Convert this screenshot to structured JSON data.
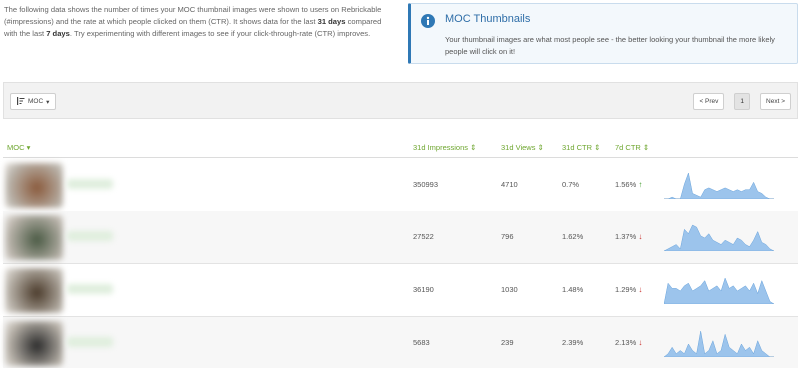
{
  "intro": {
    "part1": "The following data shows the number of times your MOC thumbnail images were shown to users on Rebrickable (#impressions) and the rate at which people clicked on them (CTR). It shows data for the last ",
    "bold1": "31 days",
    "part2": " compared with the last ",
    "bold2": "7 days",
    "part3": ". Try experimenting with different images to see if your click-through-rate (CTR) improves."
  },
  "info": {
    "title": "MOC Thumbnails",
    "body": "Your thumbnail images are what most people see - the better looking your thumbnail the more likely people will click on it!"
  },
  "toolbar": {
    "sort_label": "MOC",
    "prev_label": "< Prev",
    "page_label": "1",
    "next_label": "Next >"
  },
  "table": {
    "headers": {
      "moc": "MOC",
      "impressions": "31d Impressions",
      "views": "31d Views",
      "ctr31": "31d CTR",
      "ctr7": "7d CTR"
    },
    "rows": [
      {
        "impressions": "350993",
        "views": "4710",
        "ctr31": "0.7%",
        "ctr7": "1.56%",
        "trend": "up",
        "thumb_color": "#8a5a3c",
        "spark": [
          0,
          0,
          1,
          0,
          0,
          8,
          14,
          3,
          2,
          1,
          5,
          6,
          5,
          4,
          5,
          6,
          5,
          4,
          5,
          4,
          5,
          5,
          9,
          4,
          3,
          1,
          0,
          0
        ]
      },
      {
        "impressions": "27522",
        "views": "796",
        "ctr31": "1.62%",
        "ctr7": "1.37%",
        "trend": "down",
        "thumb_color": "#4a5a44",
        "spark": [
          0,
          1,
          2,
          3,
          1,
          10,
          8,
          12,
          11,
          7,
          6,
          8,
          5,
          4,
          3,
          5,
          4,
          3,
          6,
          5,
          3,
          2,
          5,
          9,
          4,
          3,
          1,
          0
        ]
      },
      {
        "impressions": "36190",
        "views": "1030",
        "ctr31": "1.48%",
        "ctr7": "1.29%",
        "trend": "down",
        "thumb_color": "#4a3a2a",
        "spark": [
          0,
          8,
          6,
          6,
          5,
          7,
          8,
          5,
          6,
          7,
          9,
          5,
          6,
          7,
          5,
          10,
          6,
          7,
          5,
          6,
          7,
          5,
          8,
          4,
          9,
          5,
          1,
          0
        ]
      },
      {
        "impressions": "5683",
        "views": "239",
        "ctr31": "2.39%",
        "ctr7": "2.13%",
        "trend": "down",
        "thumb_color": "#2a2a2a",
        "spark": [
          0,
          1,
          3,
          1,
          2,
          1,
          4,
          2,
          1,
          8,
          1,
          2,
          5,
          1,
          2,
          7,
          3,
          2,
          1,
          4,
          2,
          3,
          1,
          5,
          2,
          1,
          0,
          0
        ]
      }
    ]
  },
  "colors": {
    "accent_green": "#6ea62f",
    "info_blue": "#2f78b5",
    "spark_fill": "#9cc4ec",
    "spark_line": "#6aa4dc"
  }
}
